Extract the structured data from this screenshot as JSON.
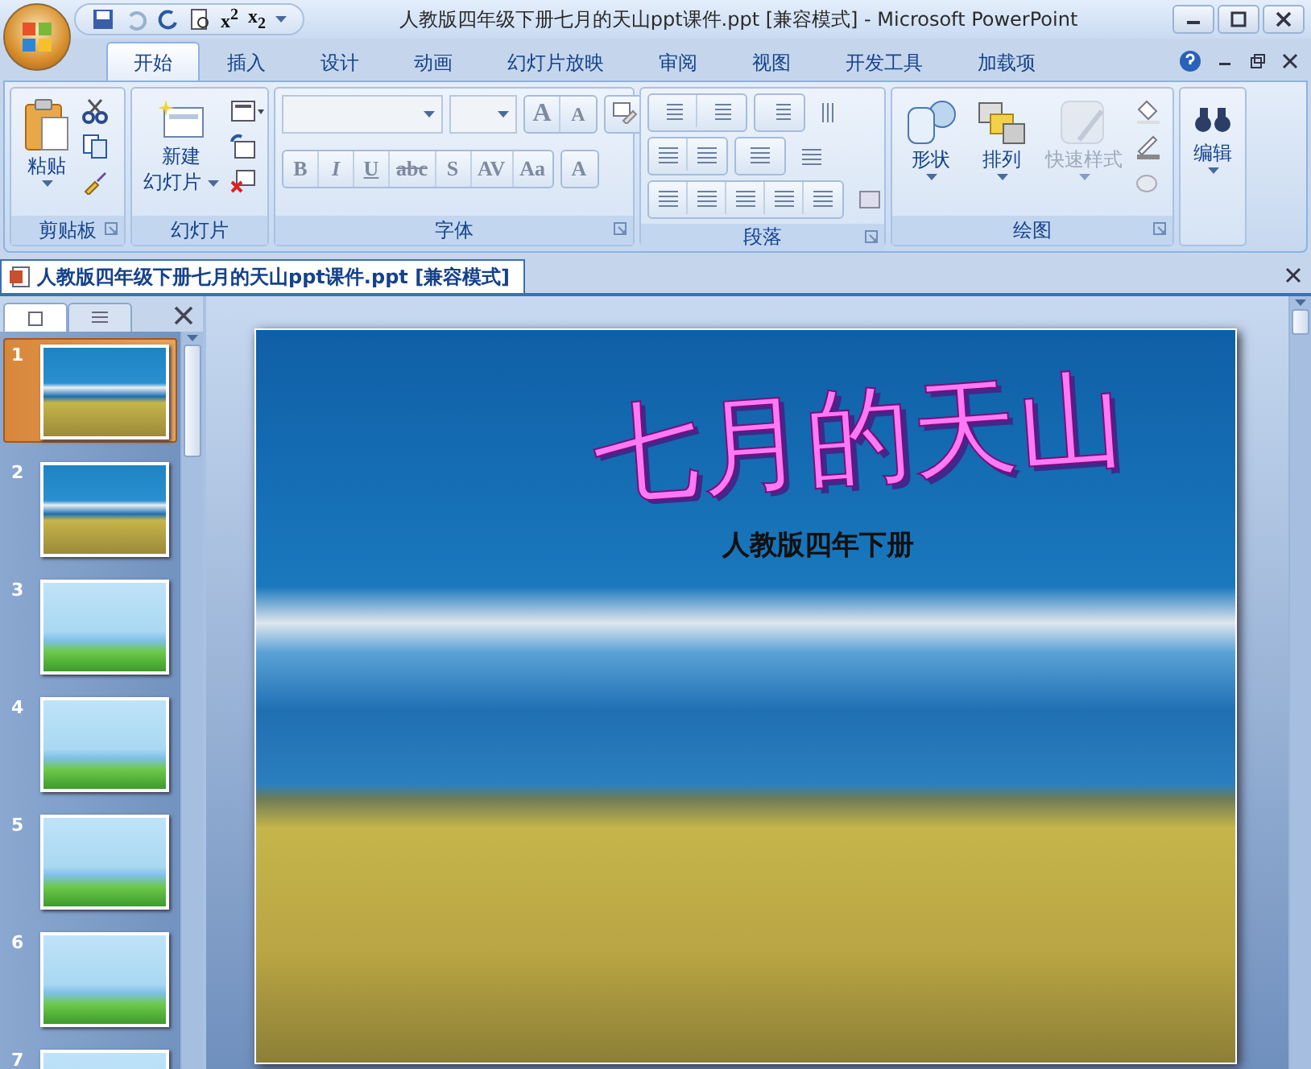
{
  "window": {
    "title": "人教版四年级下册七月的天山ppt课件.ppt [兼容模式] - Microsoft PowerPoint"
  },
  "quick_access": [
    "x$^{2}$",
    "x$_{2}$"
  ],
  "tabs": [
    {
      "label": "开始",
      "selected": true
    },
    {
      "label": "插入",
      "selected": false
    },
    {
      "label": "设计",
      "selected": false
    },
    {
      "label": "动画",
      "selected": false
    },
    {
      "label": "幻灯片放映",
      "selected": false
    },
    {
      "label": "审阅",
      "selected": false
    },
    {
      "label": "视图",
      "selected": false
    },
    {
      "label": "开发工具",
      "selected": false
    },
    {
      "label": "加载项",
      "selected": false
    }
  ],
  "ribbon": {
    "groups": [
      {
        "kind": "clipboard",
        "label": "剪贴板",
        "buttons": [
          {
            "label": "粘贴",
            "disabled": false
          }
        ]
      },
      {
        "kind": "slides",
        "label": "幻灯片",
        "buttons": [
          {
            "label": "新建",
            "disabled": false
          },
          {
            "label": "幻灯片",
            "disabled": false
          }
        ]
      },
      {
        "kind": "font",
        "label": "字体",
        "size_buttons": [
          "A",
          "A"
        ],
        "format_buttons": [
          "B",
          "I",
          "U",
          "abc",
          "S",
          "AV",
          "Aa",
          "A"
        ]
      },
      {
        "kind": "paragraph",
        "label": "段落"
      },
      {
        "kind": "drawing",
        "label": "绘图",
        "buttons": [
          {
            "label": "形状",
            "disabled": false
          },
          {
            "label": "排列",
            "disabled": false
          },
          {
            "label": "快速样式",
            "disabled": true
          }
        ]
      },
      {
        "kind": "editing",
        "buttons": [
          {
            "label": "编辑",
            "disabled": false
          }
        ]
      }
    ]
  },
  "document_tab": {
    "title": "人教版四年级下册七月的天山ppt课件.ppt [兼容模式]"
  },
  "slides": [
    {
      "number": "1",
      "kind": "title",
      "selected": true
    },
    {
      "number": "2",
      "kind": "photo",
      "selected": false
    },
    {
      "number": "3",
      "kind": "meadow",
      "selected": false
    },
    {
      "number": "4",
      "kind": "meadow",
      "selected": false
    },
    {
      "number": "5",
      "kind": "meadow",
      "selected": false
    },
    {
      "number": "6",
      "kind": "meadow",
      "selected": false
    },
    {
      "number": "7",
      "kind": "meadow",
      "selected": false
    }
  ],
  "slide": {
    "title": "七月的天山",
    "subtitle": "人教版四年下册"
  }
}
